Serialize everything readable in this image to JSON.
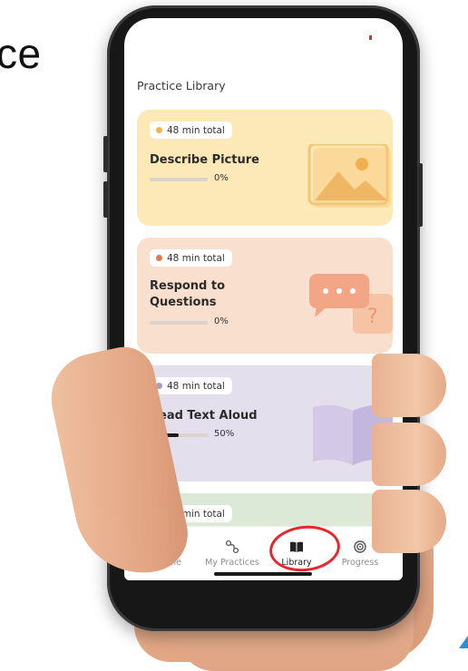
{
  "background_word": "ce",
  "screen": {
    "title": "Practice Library",
    "cards": [
      {
        "duration": "48 min total",
        "title": "Describe Picture",
        "percent": "0%",
        "progress": 0,
        "dot_color": "#f0b44c",
        "bg": "#fde8b7",
        "illustration": "picture-icon"
      },
      {
        "duration": "48 min total",
        "title": "Respond to Questions",
        "percent": "0%",
        "progress": 0,
        "dot_color": "#e07a4f",
        "bg": "#f9e0ce",
        "illustration": "speech-bubbles-icon"
      },
      {
        "duration": "48 min total",
        "title": "Read Text Aloud",
        "percent": "50%",
        "progress": 0.5,
        "dot_color": "#a79bc9",
        "bg": "#e4dfec",
        "illustration": "open-book-icon"
      },
      {
        "duration": "48 min total",
        "dot_color": "#2f6e4f",
        "bg": "#dde9d7"
      }
    ]
  },
  "nav": {
    "items": [
      {
        "label": "Home",
        "icon": "home-icon"
      },
      {
        "label": "My Practices",
        "icon": "practices-icon"
      },
      {
        "label": "Library",
        "icon": "library-icon",
        "active": true
      },
      {
        "label": "Progress",
        "icon": "progress-icon"
      }
    ]
  },
  "colors": {
    "annotation": "#e8262b",
    "active_nav": "#222222",
    "inactive_nav": "#8c8c8c"
  }
}
